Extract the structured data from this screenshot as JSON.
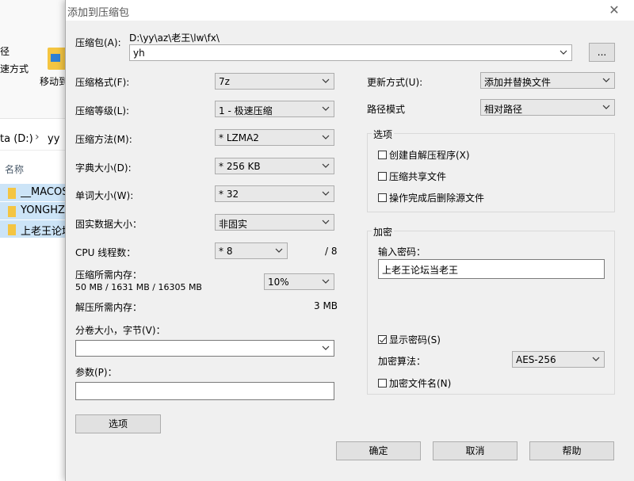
{
  "explorer": {
    "ribbon_text_1": "径",
    "ribbon_text_2": "速方式",
    "move_label": "移动到",
    "address_drive": "ta (D:)",
    "address_sep": "›",
    "address_folder": "yy",
    "column_header": "名称",
    "files": [
      "__MACOSX",
      "YONGHZ",
      "上老王论坛"
    ]
  },
  "dialog": {
    "title": "添加到压缩包",
    "close_glyph": "✕",
    "archive": {
      "label": "压缩包(A):",
      "path": "D:\\yy\\az\\老王\\lw\\fx\\",
      "name_value": "yh",
      "browse_label": "..."
    },
    "format": {
      "label": "压缩格式(F):",
      "value": "7z"
    },
    "level": {
      "label": "压缩等级(L):",
      "value": "1 - 极速压缩"
    },
    "method": {
      "label": "压缩方法(M):",
      "value": "* LZMA2"
    },
    "dict": {
      "label": "字典大小(D):",
      "value": "* 256 KB"
    },
    "word": {
      "label": "单词大小(W):",
      "value": "* 32"
    },
    "solid": {
      "label": "固实数据大小：",
      "value": "非固实"
    },
    "threads": {
      "label": "CPU 线程数：",
      "value": "* 8",
      "max": "/ 8"
    },
    "mem_compress": {
      "label": "压缩所需内存：",
      "detail": "50 MB / 1631 MB / 16305 MB",
      "percent": "10%"
    },
    "mem_decompress": {
      "label": "解压所需内存：",
      "value": "3 MB"
    },
    "volume": {
      "label": "分卷大小，字节(V)：",
      "value": ""
    },
    "params": {
      "label": "参数(P)：",
      "value": ""
    },
    "options_button": "选项",
    "update": {
      "label": "更新方式(U):",
      "value": "添加并替换文件"
    },
    "path_mode": {
      "label": "路径模式",
      "value": "相对路径"
    },
    "options_group": {
      "title": "选项",
      "sfx": "创建自解压程序(X)",
      "shared": "压缩共享文件",
      "delete_after": "操作完成后删除源文件"
    },
    "encryption": {
      "title": "加密",
      "password_label": "输入密码：",
      "password_value": "上老王论坛当老王",
      "show_password": "显示密码(S)",
      "show_password_checked": true,
      "method_label": "加密算法：",
      "method_value": "AES-256",
      "encrypt_names": "加密文件名(N)"
    },
    "ok": "确定",
    "cancel": "取消",
    "help": "帮助"
  }
}
